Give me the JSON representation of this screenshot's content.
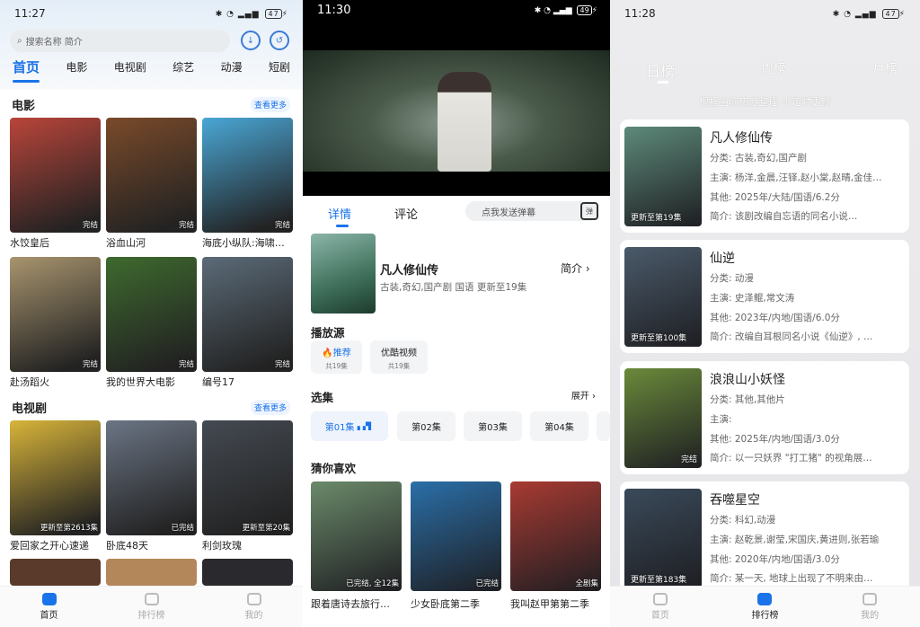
{
  "left": {
    "status": {
      "time": "11:27",
      "battery": "47"
    },
    "search_placeholder": "搜索名称 简介",
    "tabs": [
      "首页",
      "电影",
      "电视剧",
      "综艺",
      "动漫",
      "短剧"
    ],
    "movie_section": {
      "title": "电影",
      "more": "查看更多"
    },
    "movies": [
      {
        "title": "水饺皇后",
        "badge": "完结",
        "color": "#b9453a"
      },
      {
        "title": "浴血山河",
        "badge": "完结",
        "color": "#7a4a2a"
      },
      {
        "title": "海底小纵队:海啸…",
        "badge": "完结",
        "color": "#4aa7d6"
      },
      {
        "title": "赴汤蹈火",
        "badge": "完结",
        "color": "#a8946e"
      },
      {
        "title": "我的世界大电影",
        "badge": "完结",
        "color": "#3e6a2e"
      },
      {
        "title": "编号17",
        "badge": "完结",
        "color": "#5b6b78"
      }
    ],
    "tv_section": {
      "title": "电视剧",
      "more": "查看更多"
    },
    "tv": [
      {
        "title": "爱回家之开心速递",
        "badge": "更新至第2613集",
        "color": "#d8b43a"
      },
      {
        "title": "卧底48天",
        "badge": "已完结",
        "color": "#6b7585"
      },
      {
        "title": "利剑玫瑰",
        "badge": "更新至第20集",
        "color": "#444a52"
      }
    ],
    "nav": [
      "首页",
      "排行榜",
      "我的"
    ]
  },
  "middle": {
    "status": {
      "time": "11:30",
      "battery": "49"
    },
    "tabs": [
      "详情",
      "评论"
    ],
    "danmu_placeholder": "点我发送弹幕",
    "danmu_icon": "弹",
    "show": {
      "title": "凡人修仙传",
      "info": "古装,奇幻,国产剧 国语 更新至19集",
      "intro": "简介"
    },
    "source_title": "播放源",
    "sources": [
      {
        "name": "🔥推荐",
        "count": "共19集"
      },
      {
        "name": "优酷视频",
        "count": "共19集"
      }
    ],
    "episodes_title": "选集",
    "expand": "展开",
    "episodes": [
      "第01集",
      "第02集",
      "第03集",
      "第04集"
    ],
    "guess_title": "猜你喜欢",
    "recs": [
      {
        "title": "跟着唐诗去旅行…",
        "badge": "已完结, 全12集",
        "color": "#6b8a6a"
      },
      {
        "title": "少女卧底第二季",
        "badge": "已完结",
        "color": "#2a6fa8"
      },
      {
        "title": "我叫赵甲第第二季",
        "badge": "全剧集",
        "color": "#a83a32"
      }
    ]
  },
  "right": {
    "status": {
      "time": "11:28",
      "battery": "47"
    },
    "tabs": [
      "日榜",
      "周榜",
      "月榜"
    ],
    "note": "根据当前热度整理 不定时更新",
    "items": [
      {
        "name": "凡人修仙传",
        "type": "分类: 古装,奇幻,国产剧",
        "cast": "主演: 杨洋,金晨,汪铎,赵小棠,赵晴,金佳…",
        "other": "其他: 2025年/大陆/国语/6.2分",
        "intro": "简介:        该剧改编自忘语的同名小说…",
        "badge": "更新至第19集",
        "color": "#5d8a7a"
      },
      {
        "name": "仙逆",
        "type": "分类: 动漫",
        "cast": "主演: 史泽鲲,常文涛",
        "other": "其他: 2023年/内地/国语/6.0分",
        "intro": "简介: 改编自耳根同名小说《仙逆》, …",
        "badge": "更新至第100集",
        "color": "#4a5a6a"
      },
      {
        "name": "浪浪山小妖怪",
        "type": "分类: 其他,其他片",
        "cast": "主演:",
        "other": "其他: 2025年/内地/国语/3.0分",
        "intro": "简介: 以一只妖界 \"打工猪\" 的视角展…",
        "badge": "完结",
        "color": "#6a8a3a"
      },
      {
        "name": "吞噬星空",
        "type": "分类: 科幻,动漫",
        "cast": "主演: 赵乾景,谢莹,宋国庆,黄进则,张若瑜",
        "other": "其他: 2020年/内地/国语/3.0分",
        "intro": "简介: 某一天, 地球上出现了不明来由…",
        "badge": "更新至第183集",
        "color": "#3a4a5a"
      }
    ],
    "nav": [
      "首页",
      "排行榜",
      "我的"
    ]
  }
}
